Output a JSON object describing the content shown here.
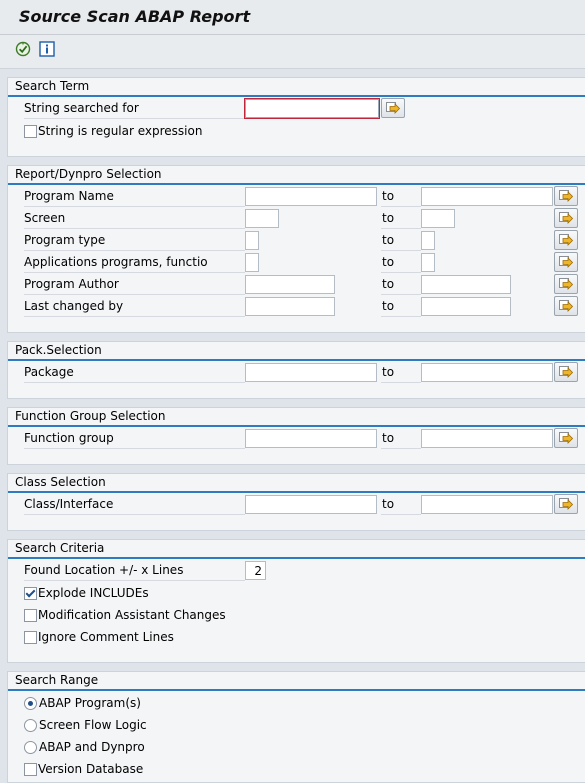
{
  "window": {
    "title": "Source Scan ABAP Report"
  },
  "toolbar": {
    "execute_icon": "execute-icon",
    "info_icon": "info-icon"
  },
  "search_term": {
    "title": "Search Term",
    "string_label": "String searched for",
    "string_value": "",
    "regex_label": "String is regular expression",
    "regex_checked": false
  },
  "report_selection": {
    "title": "Report/Dynpro Selection",
    "to_label": "to",
    "rows": [
      {
        "label": "Program Name"
      },
      {
        "label": "Screen"
      },
      {
        "label": "Program type"
      },
      {
        "label": "Applications programs, functio"
      },
      {
        "label": "Program Author"
      },
      {
        "label": "Last changed by"
      }
    ]
  },
  "pack_selection": {
    "title": "Pack.Selection",
    "label": "Package",
    "to_label": "to"
  },
  "function_group_selection": {
    "title": "Function Group Selection",
    "label": "Function group",
    "to_label": "to"
  },
  "class_selection": {
    "title": "Class Selection",
    "label": "Class/Interface",
    "to_label": "to"
  },
  "search_criteria": {
    "title": "Search Criteria",
    "lines_label": "Found Location +/- x Lines",
    "lines_value": "2",
    "explode_label": "Explode INCLUDEs",
    "explode_checked": true,
    "mod_label": "Modification Assistant Changes",
    "mod_checked": false,
    "ignore_label": "Ignore Comment Lines",
    "ignore_checked": false
  },
  "search_range": {
    "title": "Search Range",
    "options": [
      {
        "label": "ABAP Program(s)",
        "selected": true
      },
      {
        "label": "Screen Flow Logic",
        "selected": false
      },
      {
        "label": "ABAP and Dynpro",
        "selected": false
      }
    ],
    "partial_label": "Version Database"
  },
  "colors": {
    "accent_line": "#2f7bbf",
    "background": "#dfe4ea",
    "group_bg": "#f4f5f7"
  }
}
